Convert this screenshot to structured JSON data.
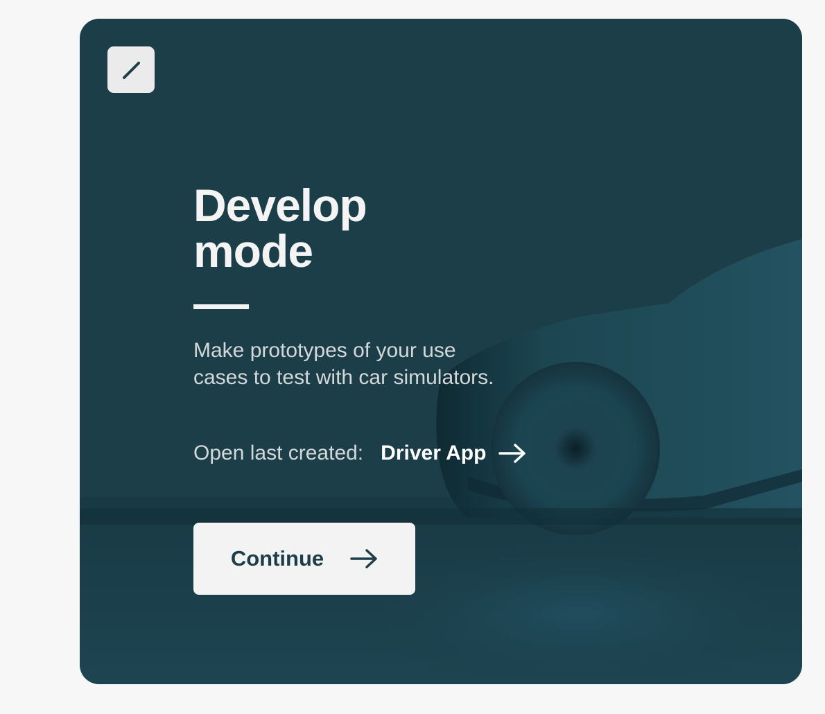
{
  "card": {
    "title_line1": "Develop",
    "title_line2": "mode",
    "description": "Make prototypes of your use cases to test with car simulators.",
    "last_created_label": "Open last created:",
    "last_created_name": "Driver App",
    "continue_label": "Continue"
  },
  "icons": {
    "edit": "pencil-icon",
    "link_arrow": "arrow-right-icon",
    "button_arrow": "arrow-right-icon"
  },
  "colors": {
    "page_background": "#f7f7f7",
    "card_background": "#1c3e49",
    "button_background": "#f3f3f3",
    "primary_text": "#f4f4f4",
    "secondary_text": "#d3d8da",
    "accent": "#1c3e49"
  }
}
